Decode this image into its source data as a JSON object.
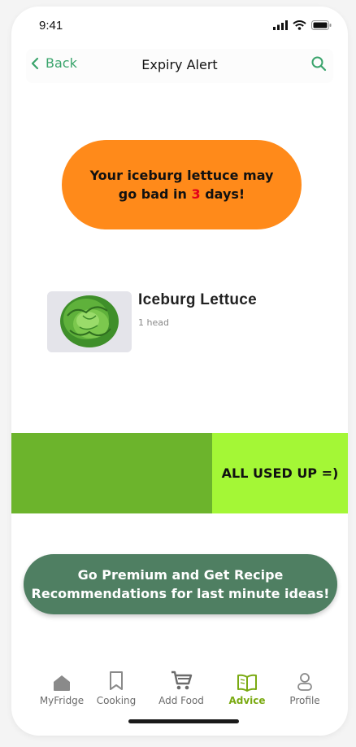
{
  "status_bar": {
    "time": "9:41"
  },
  "nav": {
    "back_label": "Back",
    "title": "Expiry Alert"
  },
  "alert": {
    "line_before": "Your iceburg lettuce may go bad in ",
    "days": "3",
    "line_after": " days!"
  },
  "food": {
    "name": "Iceburg Lettuce",
    "quantity": "1 head"
  },
  "swipe": {
    "action_label": "ALL USED UP =)"
  },
  "premium": {
    "label": "Go Premium and Get Recipe Recommendations for last minute ideas!"
  },
  "tabs": [
    {
      "label": "MyFridge",
      "icon": "home-icon"
    },
    {
      "label": "Cooking",
      "icon": "bookmark-icon"
    },
    {
      "label": "Add Food",
      "icon": "cart-icon"
    },
    {
      "label": "Advice",
      "icon": "book-icon",
      "active": true
    },
    {
      "label": "Profile",
      "icon": "person-icon"
    }
  ],
  "colors": {
    "accent_green": "#3aa46c",
    "alert_orange": "#ff8a1a",
    "alert_red": "#e3001b",
    "swipe_green": "#6cb42c",
    "swipe_lime": "#a4f736",
    "premium_green": "#4f7f62",
    "tab_active": "#7aaa12"
  }
}
